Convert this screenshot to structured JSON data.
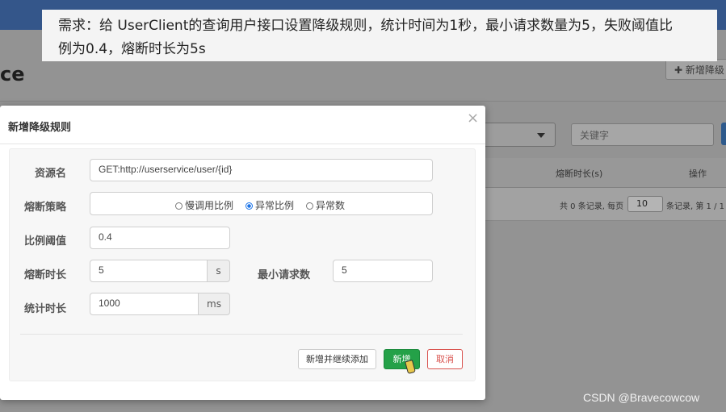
{
  "banner": {
    "line1": "需求：给 UserClient的查询用户接口设置降级规则，统计时间为1秒，最小请求数量为5，失败阈值比",
    "line2": "例为0.4，熔断时长为5s"
  },
  "background": {
    "title_fragment": "ce",
    "add_button": "✚ 新增降级",
    "search_placeholder": "关键字",
    "table_headers": [
      "熔断时长(s)",
      "操作"
    ],
    "pager": {
      "prefix": "共 0 条记录, 每页",
      "page_size": "10",
      "suffix": "条记录, 第 1 / 1"
    }
  },
  "modal": {
    "title": "新增降级规则",
    "close": "×",
    "fields": {
      "resource": {
        "label": "资源名",
        "value": "GET:http://userservice/user/{id}"
      },
      "strategy": {
        "label": "熔断策略",
        "options": [
          "慢调用比例",
          "异常比例",
          "异常数"
        ],
        "selected": "异常比例"
      },
      "ratio": {
        "label": "比例阈值",
        "value": "0.4"
      },
      "duration": {
        "label": "熔断时长",
        "value": "5",
        "unit": "s"
      },
      "min_requests": {
        "label": "最小请求数",
        "value": "5"
      },
      "stat_interval": {
        "label": "统计时长",
        "value": "1000",
        "unit": "ms"
      }
    },
    "buttons": {
      "add_continue": "新增并继续添加",
      "add": "新增",
      "cancel": "取消"
    }
  },
  "watermark": "CSDN @Bravecowcow"
}
